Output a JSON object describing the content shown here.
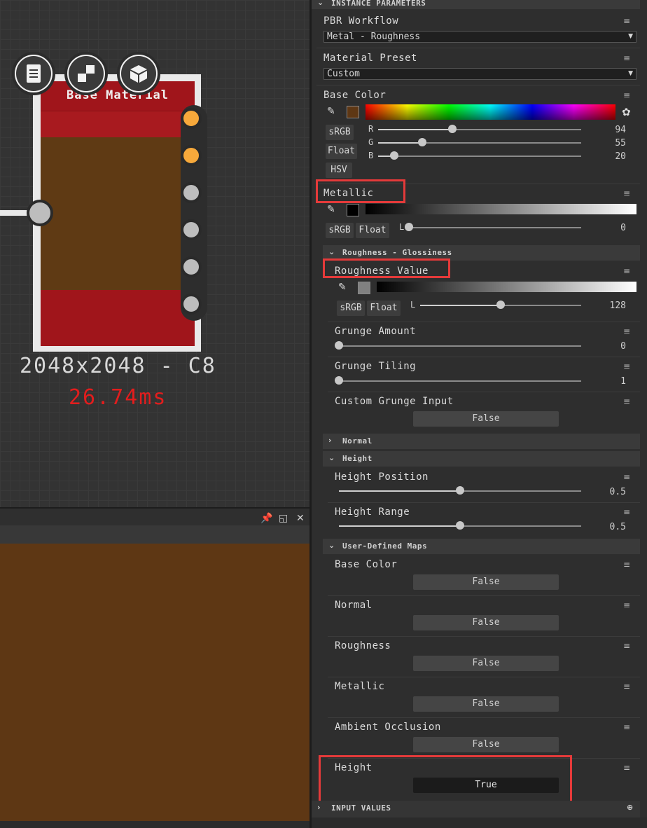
{
  "graph": {
    "node_title": "Base Material",
    "resolution_text": "2048x2048 - C8",
    "timing_text": "26.74ms",
    "colors": {
      "base_red": "#a0151b",
      "base_brown": "#5f3a14",
      "pin_orange": "#f7a93b",
      "pin_gray": "#bdbdbd"
    }
  },
  "view2d": {
    "image_color": "#5e3714"
  },
  "panel": {
    "header_title": "INSTANCE PARAMETERS",
    "pbr_workflow": {
      "label": "PBR Workflow",
      "value": "Metal - Roughness"
    },
    "material_preset": {
      "label": "Material Preset",
      "value": "Custom"
    },
    "base_color": {
      "label": "Base Color",
      "swatch": "#5e3714",
      "modes": [
        "sRGB",
        "Float",
        "HSV"
      ],
      "channels": [
        {
          "name": "R",
          "value": "94"
        },
        {
          "name": "G",
          "value": "55"
        },
        {
          "name": "B",
          "value": "20"
        }
      ]
    },
    "metallic": {
      "label": "Metallic",
      "modes": [
        "sRGB",
        "Float"
      ],
      "channel": "L",
      "value": "0"
    },
    "roughness_section": {
      "title": "Roughness - Glossiness"
    },
    "roughness_value": {
      "label": "Roughness Value",
      "modes": [
        "sRGB",
        "Float"
      ],
      "channel": "L",
      "value": "128"
    },
    "grunge_amount": {
      "label": "Grunge Amount",
      "value": "0"
    },
    "grunge_tiling": {
      "label": "Grunge Tiling",
      "value": "1"
    },
    "custom_grunge": {
      "label": "Custom Grunge Input",
      "value": "False"
    },
    "normal_section": {
      "title": "Normal"
    },
    "height_section": {
      "title": "Height"
    },
    "height_position": {
      "label": "Height Position",
      "value": "0.5"
    },
    "height_range": {
      "label": "Height Range",
      "value": "0.5"
    },
    "user_maps_section": {
      "title": "User-Defined Maps"
    },
    "user_maps": [
      {
        "label": "Base Color",
        "value": "False"
      },
      {
        "label": "Normal",
        "value": "False"
      },
      {
        "label": "Roughness",
        "value": "False"
      },
      {
        "label": "Metallic",
        "value": "False"
      },
      {
        "label": "Ambient Occlusion",
        "value": "False"
      },
      {
        "label": "Height",
        "value": "True"
      }
    ],
    "input_values_title": "INPUT VALUES"
  }
}
